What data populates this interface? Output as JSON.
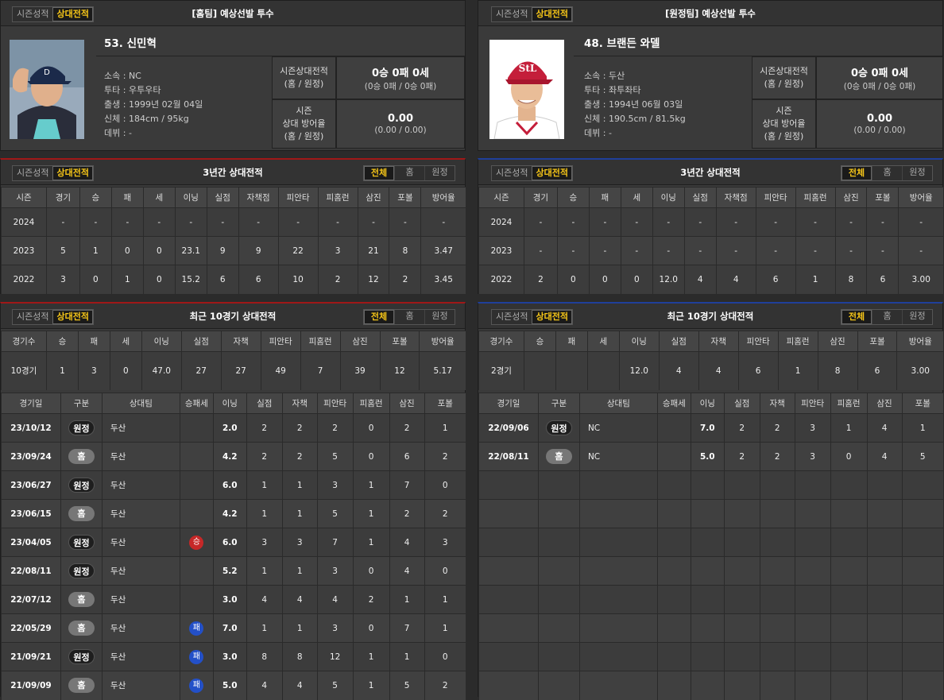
{
  "tabs": {
    "season": "시즌성적",
    "vs": "상대전적"
  },
  "filters": {
    "all": "전체",
    "home": "홈",
    "away": "원정"
  },
  "home": {
    "header": "[홈팀] 예상선발 투수",
    "name": "53. 신민혁",
    "info": [
      {
        "label": "소속 :",
        "value": "NC"
      },
      {
        "label": "투타 :",
        "value": "우투우타"
      },
      {
        "label": "출생 :",
        "value": "1999년 02월 04일"
      },
      {
        "label": "신체 :",
        "value": "184cm / 95kg"
      },
      {
        "label": "데뷔 :",
        "value": "-"
      }
    ],
    "rec_label1": "시즌상대전적",
    "rec_label2": "(홈 / 원정)",
    "rec_main": "0승 0패 0세",
    "rec_sub": "(0승 0패 / 0승 0패)",
    "era_label1": "시즌",
    "era_label2": "상대 방어율",
    "era_label3": "(홈 / 원정)",
    "era_main": "0.00",
    "era_sub": "(0.00 / 0.00)",
    "three_title": "3년간 상대전적",
    "three_cols": [
      "시즌",
      "경기",
      "승",
      "패",
      "세",
      "이닝",
      "실점",
      "자책점",
      "피안타",
      "피홈런",
      "삼진",
      "포볼",
      "방어율"
    ],
    "three_rows": [
      [
        "2024",
        "-",
        "-",
        "-",
        "-",
        "-",
        "-",
        "-",
        "-",
        "-",
        "-",
        "-",
        "-"
      ],
      [
        "2023",
        "5",
        "1",
        "0",
        "0",
        "23.1",
        "9",
        "9",
        "22",
        "3",
        "21",
        "8",
        "3.47"
      ],
      [
        "2022",
        "3",
        "0",
        "1",
        "0",
        "15.2",
        "6",
        "6",
        "10",
        "2",
        "12",
        "2",
        "3.45"
      ]
    ],
    "ten_title": "최근 10경기 상대전적",
    "sum_cols": [
      "경기수",
      "승",
      "패",
      "세",
      "이닝",
      "실점",
      "자책",
      "피안타",
      "피홈런",
      "삼진",
      "포볼",
      "방어율"
    ],
    "sum_row": [
      "10경기",
      "1",
      "3",
      "0",
      "47.0",
      "27",
      "27",
      "49",
      "7",
      "39",
      "12",
      "5.17"
    ],
    "game_cols": [
      "경기일",
      "구분",
      "상대팀",
      "승패세",
      "이닝",
      "실점",
      "자책",
      "피안타",
      "피홈런",
      "삼진",
      "포볼"
    ],
    "games": [
      {
        "date": "23/10/12",
        "loc": "원정",
        "type": "away",
        "opp": "두산",
        "res": "",
        "rtype": "",
        "ip": "2.0",
        "r": "2",
        "er": "2",
        "h": "2",
        "hr": "0",
        "so": "2",
        "bb": "1"
      },
      {
        "date": "23/09/24",
        "loc": "홈",
        "type": "home",
        "opp": "두산",
        "res": "",
        "rtype": "",
        "ip": "4.2",
        "r": "2",
        "er": "2",
        "h": "5",
        "hr": "0",
        "so": "6",
        "bb": "2"
      },
      {
        "date": "23/06/27",
        "loc": "원정",
        "type": "away",
        "opp": "두산",
        "res": "",
        "rtype": "",
        "ip": "6.0",
        "r": "1",
        "er": "1",
        "h": "3",
        "hr": "1",
        "so": "7",
        "bb": "0"
      },
      {
        "date": "23/06/15",
        "loc": "홈",
        "type": "home",
        "opp": "두산",
        "res": "",
        "rtype": "",
        "ip": "4.2",
        "r": "1",
        "er": "1",
        "h": "5",
        "hr": "1",
        "so": "2",
        "bb": "2"
      },
      {
        "date": "23/04/05",
        "loc": "원정",
        "type": "away",
        "opp": "두산",
        "res": "승",
        "rtype": "win",
        "ip": "6.0",
        "r": "3",
        "er": "3",
        "h": "7",
        "hr": "1",
        "so": "4",
        "bb": "3"
      },
      {
        "date": "22/08/11",
        "loc": "원정",
        "type": "away",
        "opp": "두산",
        "res": "",
        "rtype": "",
        "ip": "5.2",
        "r": "1",
        "er": "1",
        "h": "3",
        "hr": "0",
        "so": "4",
        "bb": "0"
      },
      {
        "date": "22/07/12",
        "loc": "홈",
        "type": "home",
        "opp": "두산",
        "res": "",
        "rtype": "",
        "ip": "3.0",
        "r": "4",
        "er": "4",
        "h": "4",
        "hr": "2",
        "so": "1",
        "bb": "1"
      },
      {
        "date": "22/05/29",
        "loc": "홈",
        "type": "home",
        "opp": "두산",
        "res": "패",
        "rtype": "loss",
        "ip": "7.0",
        "r": "1",
        "er": "1",
        "h": "3",
        "hr": "0",
        "so": "7",
        "bb": "1"
      },
      {
        "date": "21/09/21",
        "loc": "원정",
        "type": "away",
        "opp": "두산",
        "res": "패",
        "rtype": "loss",
        "ip": "3.0",
        "r": "8",
        "er": "8",
        "h": "12",
        "hr": "1",
        "so": "1",
        "bb": "0"
      },
      {
        "date": "21/09/09",
        "loc": "홈",
        "type": "home",
        "opp": "두산",
        "res": "패",
        "rtype": "loss",
        "ip": "5.0",
        "r": "4",
        "er": "4",
        "h": "5",
        "hr": "1",
        "so": "5",
        "bb": "2"
      }
    ]
  },
  "away": {
    "header": "[원정팀] 예상선발 투수",
    "name": "48. 브랜든 와델",
    "info": [
      {
        "label": "소속 :",
        "value": "두산"
      },
      {
        "label": "투타 :",
        "value": "좌투좌타"
      },
      {
        "label": "출생 :",
        "value": "1994년 06월 03일"
      },
      {
        "label": "신체 :",
        "value": "190.5cm / 81.5kg"
      },
      {
        "label": "데뷔 :",
        "value": "-"
      }
    ],
    "rec_label1": "시즌상대전적",
    "rec_label2": "(홈 / 원정)",
    "rec_main": "0승 0패 0세",
    "rec_sub": "(0승 0패 / 0승 0패)",
    "era_label1": "시즌",
    "era_label2": "상대 방어율",
    "era_label3": "(홈 / 원정)",
    "era_main": "0.00",
    "era_sub": "(0.00 / 0.00)",
    "three_title": "3년간 상대전적",
    "three_cols": [
      "시즌",
      "경기",
      "승",
      "패",
      "세",
      "이닝",
      "실점",
      "자책점",
      "피안타",
      "피홈런",
      "삼진",
      "포볼",
      "방어율"
    ],
    "three_rows": [
      [
        "2024",
        "-",
        "-",
        "-",
        "-",
        "-",
        "-",
        "-",
        "-",
        "-",
        "-",
        "-",
        "-"
      ],
      [
        "2023",
        "-",
        "-",
        "-",
        "-",
        "-",
        "-",
        "-",
        "-",
        "-",
        "-",
        "-",
        "-"
      ],
      [
        "2022",
        "2",
        "0",
        "0",
        "0",
        "12.0",
        "4",
        "4",
        "6",
        "1",
        "8",
        "6",
        "3.00"
      ]
    ],
    "ten_title": "최근 10경기 상대전적",
    "sum_cols": [
      "경기수",
      "승",
      "패",
      "세",
      "이닝",
      "실점",
      "자책",
      "피안타",
      "피홈런",
      "삼진",
      "포볼",
      "방어율"
    ],
    "sum_row": [
      "2경기",
      "",
      "",
      "",
      "12.0",
      "4",
      "4",
      "6",
      "1",
      "8",
      "6",
      "3.00"
    ],
    "game_cols": [
      "경기일",
      "구분",
      "상대팀",
      "승패세",
      "이닝",
      "실점",
      "자책",
      "피안타",
      "피홈런",
      "삼진",
      "포볼"
    ],
    "games": [
      {
        "date": "22/09/06",
        "loc": "원정",
        "type": "away",
        "opp": "NC",
        "res": "",
        "rtype": "",
        "ip": "7.0",
        "r": "2",
        "er": "2",
        "h": "3",
        "hr": "1",
        "so": "4",
        "bb": "1"
      },
      {
        "date": "22/08/11",
        "loc": "홈",
        "type": "home",
        "opp": "NC",
        "res": "",
        "rtype": "",
        "ip": "5.0",
        "r": "2",
        "er": "2",
        "h": "3",
        "hr": "0",
        "so": "4",
        "bb": "5"
      }
    ]
  }
}
